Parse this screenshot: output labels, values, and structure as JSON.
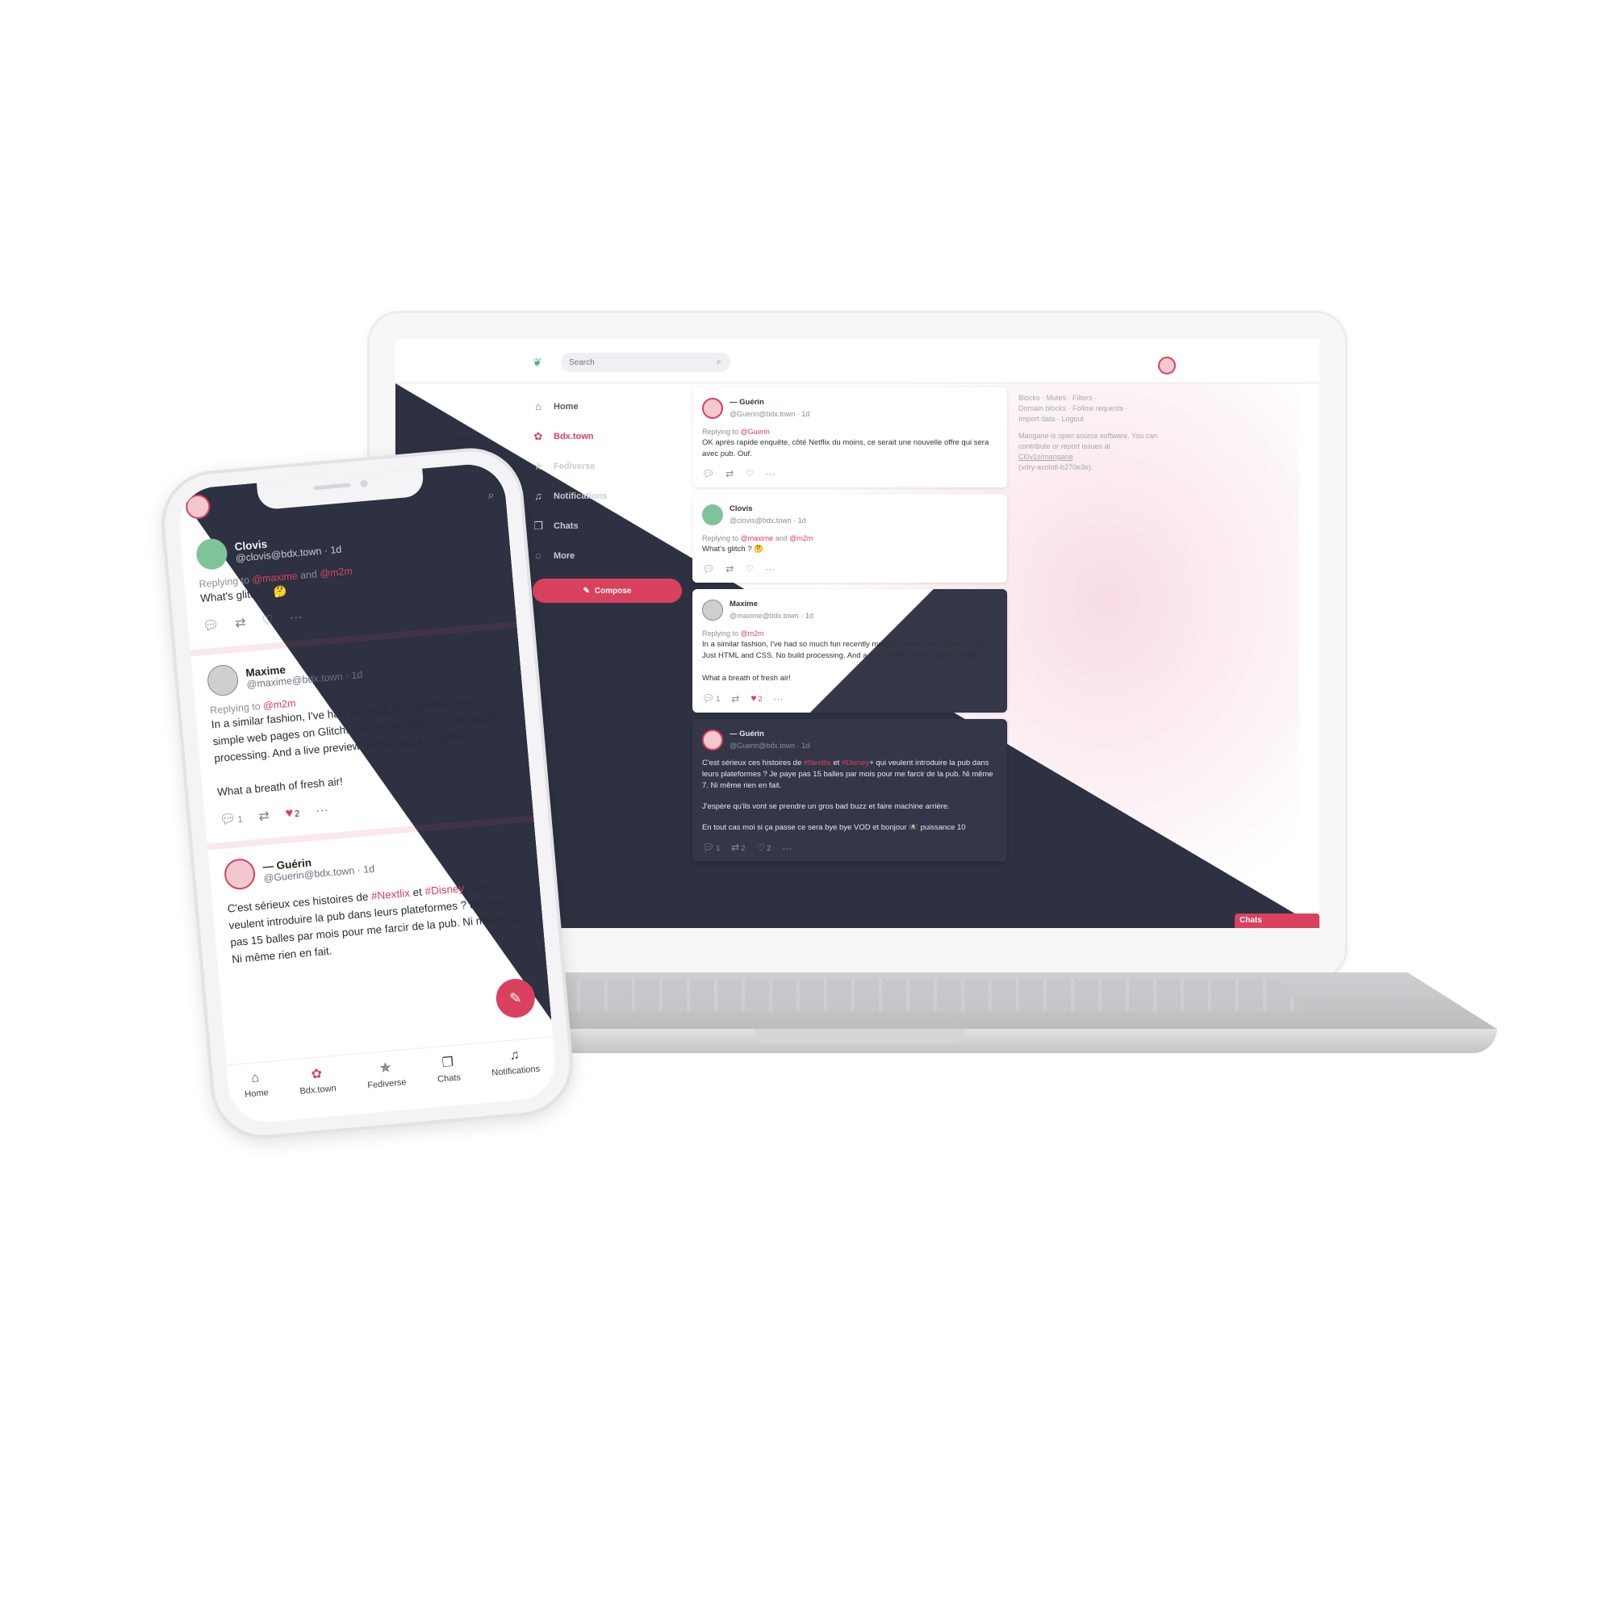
{
  "desktop": {
    "search": {
      "placeholder": "Search"
    },
    "nav": [
      {
        "label": "Home",
        "icon": "home-icon"
      },
      {
        "label": "Bdx.town",
        "icon": "instance-icon"
      },
      {
        "label": "Fediverse",
        "icon": "fediverse-icon"
      },
      {
        "label": "Notifications",
        "icon": "bell-icon"
      },
      {
        "label": "Chats",
        "icon": "chat-icon"
      },
      {
        "label": "More",
        "icon": "more-icon"
      }
    ],
    "compose_label": "Compose",
    "posts": [
      {
        "name": "— Guérin",
        "handle": "@Guerin@bdx.town · 1d",
        "reply_prefix": "Replying to",
        "reply_to": "@Guerin",
        "text": "OK après rapide enquête, côté Netflix du moins, ce serait une nouvelle offre qui sera avec pub. Ouf."
      },
      {
        "name": "Clovis",
        "handle": "@clovis@bdx.town · 1d",
        "reply_prefix": "Replying to",
        "reply_to_1": "@maxime",
        "reply_and": "and",
        "reply_to_2": "@m2m",
        "text": "What's glitch ? 🤔"
      },
      {
        "name": "Maxime",
        "handle": "@maxime@bdx.town · 1d",
        "reply_prefix": "Replying to",
        "reply_to": "@m2m",
        "text": "In a similar fashion, I've had so much fun recently making simple web pages on Glitch. Just HTML and CSS. No build processing. And a live preview on the same window.\n\nWhat a breath of fresh air!",
        "reply_count": "1",
        "like_count": "2"
      },
      {
        "name": "— Guérin",
        "handle": "@Guerin@bdx.town · 1d",
        "text_1": "C'est sérieux ces histoires de ",
        "tag_1": "#Nextlix",
        "text_2": " et ",
        "tag_2": "#Disney",
        "text_3": "+ qui veulent introduire la pub dans leurs plateformes ? Je paye pas 15 balles par mois pour me farcir de la pub. Ni même 7. Ni même rien en fait.",
        "text_4": "J'espère qu'ils vont se prendre un gros bad buzz et faire machine arrière.",
        "text_5": "En tout cas moi si ça passe ce sera bye bye VOD et bonjour 🏴‍☠️ puissance 10",
        "reply_count": "1",
        "repost_count": "2",
        "like_count": "2"
      }
    ],
    "footer": {
      "links_1": "Blocks · Mutes · Filters ·",
      "links_2": "Domain blocks · Follow requests ·",
      "links_3": "Import data · Logout",
      "about_1": "Mangane is open source software. You can contribute or report issues at",
      "repo": "Cl0v1s/mangane",
      "version": "(vdry-axolotl-b270e3e)."
    },
    "chats_tab": "Chats"
  },
  "mobile": {
    "posts": [
      {
        "name": "Clovis",
        "handle": "@clovis@bdx.town · 1d",
        "reply_prefix": "Replying to",
        "reply_to_1": "@maxime",
        "reply_and": "and",
        "reply_to_2": "@m2m",
        "text": "What's glitch ? 🤔"
      },
      {
        "name": "Maxime",
        "handle": "@maxime@bdx.town · 1d",
        "reply_prefix": "Replying to",
        "reply_to": "@m2m",
        "text": "In a similar fashion, I've had so much fun recently making simple web pages on Glitch. Just HTML and CSS. No build processing. And a live preview on the same window.\n\nWhat a breath of fresh air!",
        "reply_count": "1",
        "like_count": "2"
      },
      {
        "name": "— Guérin",
        "handle": "@Guerin@bdx.town · 1d",
        "text_1": "C'est sérieux ces histoires de ",
        "tag_1": "#Nextlix",
        "text_2": " et ",
        "tag_2": "#Disney",
        "text_3": "+ qui veulent introduire la pub dans leurs plateformes ? Je paye pas 15 balles par mois pour me farcir de la pub. Ni même 7. Ni même rien en fait."
      }
    ],
    "tabs": [
      {
        "label": "Home",
        "icon": "home-icon"
      },
      {
        "label": "Bdx.town",
        "icon": "instance-icon"
      },
      {
        "label": "Fediverse",
        "icon": "fediverse-icon"
      },
      {
        "label": "Chats",
        "icon": "chat-icon"
      },
      {
        "label": "Notifications",
        "icon": "bell-icon"
      }
    ]
  },
  "colors": {
    "accent": "#d9415f",
    "dark": "#2d3141",
    "leaf": "#46b38a"
  }
}
